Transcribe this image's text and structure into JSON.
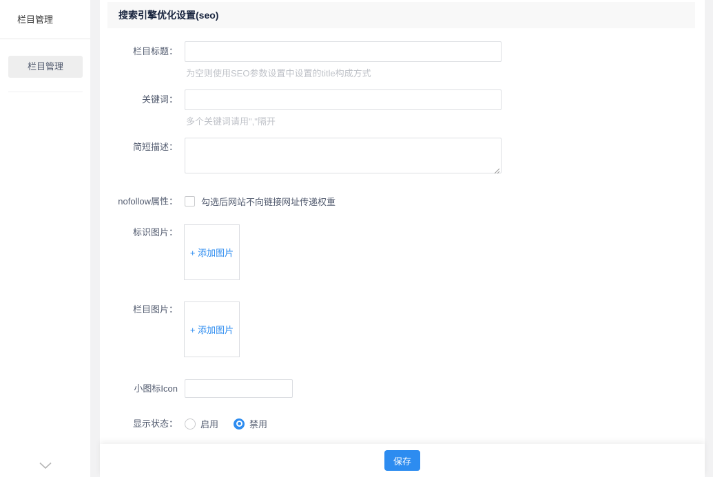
{
  "colors": {
    "accent": "#2d8cf0",
    "title_bar_bg": "#f8f8f8",
    "selected_item_bg": "#eeeeee"
  },
  "icons": {
    "sidebar_collapse": "chevron-down",
    "textarea_corner": "resize-handle"
  },
  "sidebar": {
    "title": "栏目管理",
    "items": [
      {
        "label": "栏目管理",
        "selected": true
      }
    ]
  },
  "main": {
    "title": "搜索引擎优化设置(seo)",
    "form": {
      "column_title": {
        "label": "栏目标题：",
        "value": "",
        "placeholder": "",
        "hint": "为空则使用SEO参数设置中设置的title构成方式"
      },
      "keywords": {
        "label": "关键词：",
        "value": "",
        "placeholder": "",
        "hint": "多个关键词请用\",\"隔开"
      },
      "description": {
        "label": "简短描述：",
        "value": "",
        "placeholder": ""
      },
      "nofollow": {
        "label": "nofollow属性：",
        "checkbox_label": "勾选后网站不向链接网址传递权重",
        "checked": false
      },
      "logo_image": {
        "label": "标识图片：",
        "add_label": "+ 添加图片"
      },
      "column_image": {
        "label": "栏目图片：",
        "add_label": "+ 添加图片"
      },
      "small_icon": {
        "label": "小图标Icon",
        "value": "",
        "placeholder": ""
      },
      "display_status": {
        "label": "显示状态：",
        "options": [
          {
            "label": "启用",
            "selected": false
          },
          {
            "label": "禁用",
            "selected": true
          }
        ]
      }
    },
    "footer": {
      "save_label": "保存"
    }
  }
}
